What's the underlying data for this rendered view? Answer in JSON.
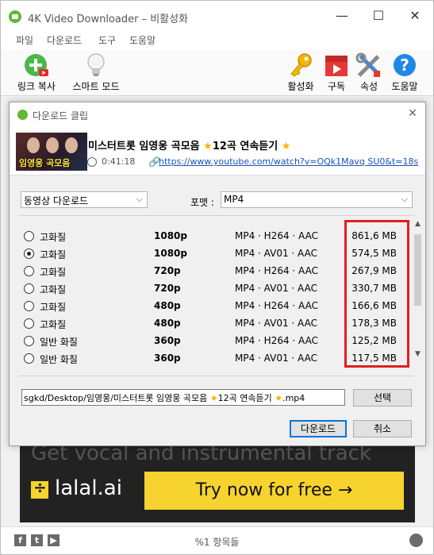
{
  "window": {
    "title": "4K Video Downloader – 비활성화",
    "min": "—",
    "max": "☐",
    "close": "✕"
  },
  "menu": [
    "파일",
    "다운로드",
    "도구",
    "도움말"
  ],
  "toolbar": {
    "paste_link": "링크 복사",
    "smart_mode": "스마트 모드",
    "activate": "활성화",
    "subscribe": "구독",
    "settings": "속성",
    "help": "도움말"
  },
  "dialog": {
    "title": "다운로드 클립",
    "close": "✕",
    "video": {
      "title_part1": "미스터트롯 임영웅 곡모음",
      "title_part2": "12곡 연속듣기",
      "star": "★",
      "thumb_caption": "임영웅 곡모음",
      "duration": "0:41:18",
      "url": "https://www.youtube.com/watch?v=OQk1Mavq SU0&t=18s"
    },
    "type_select": {
      "value": "동영상 다운로드"
    },
    "format_label": "포맷 :",
    "format_select": {
      "value": "MP4"
    },
    "options": [
      {
        "quality": "고화질",
        "resolution": "1080p",
        "format": "MP4 · H264 · AAC",
        "size": "861,6 MB",
        "selected": false
      },
      {
        "quality": "고화질",
        "resolution": "1080p",
        "format": "MP4 · AV01 · AAC",
        "size": "574,5 MB",
        "selected": true
      },
      {
        "quality": "고화질",
        "resolution": "720p",
        "format": "MP4 · H264 · AAC",
        "size": "267,9 MB",
        "selected": false
      },
      {
        "quality": "고화질",
        "resolution": "720p",
        "format": "MP4 · AV01 · AAC",
        "size": "330,7 MB",
        "selected": false
      },
      {
        "quality": "고화질",
        "resolution": "480p",
        "format": "MP4 · H264 · AAC",
        "size": "166,6 MB",
        "selected": false
      },
      {
        "quality": "고화질",
        "resolution": "480p",
        "format": "MP4 · AV01 · AAC",
        "size": "178,3 MB",
        "selected": false
      },
      {
        "quality": "일반 화질",
        "resolution": "360p",
        "format": "MP4 · H264 · AAC",
        "size": "125,2 MB",
        "selected": false
      },
      {
        "quality": "일반 화질",
        "resolution": "360p",
        "format": "MP4 · AV01 · AAC",
        "size": "117,5 MB",
        "selected": false
      }
    ],
    "path": {
      "value_part1": "sgkd/Desktop/임영웅/미스터트롯 임영웅 곡모음",
      "value_part2": "12곡 연속듣기",
      "value_part3": ".mp4"
    },
    "choose_button": "선택",
    "download_button": "다운로드",
    "cancel_button": "취소"
  },
  "ad": {
    "headline": "Get vocal and instrumental track",
    "brand": "lalal.ai",
    "cta": "Try now for free →"
  },
  "status": {
    "text": "%1 항목들"
  },
  "colors": {
    "highlight": "#e21e1e",
    "ad_accent": "#f6d32e",
    "link": "#1a54b8"
  }
}
